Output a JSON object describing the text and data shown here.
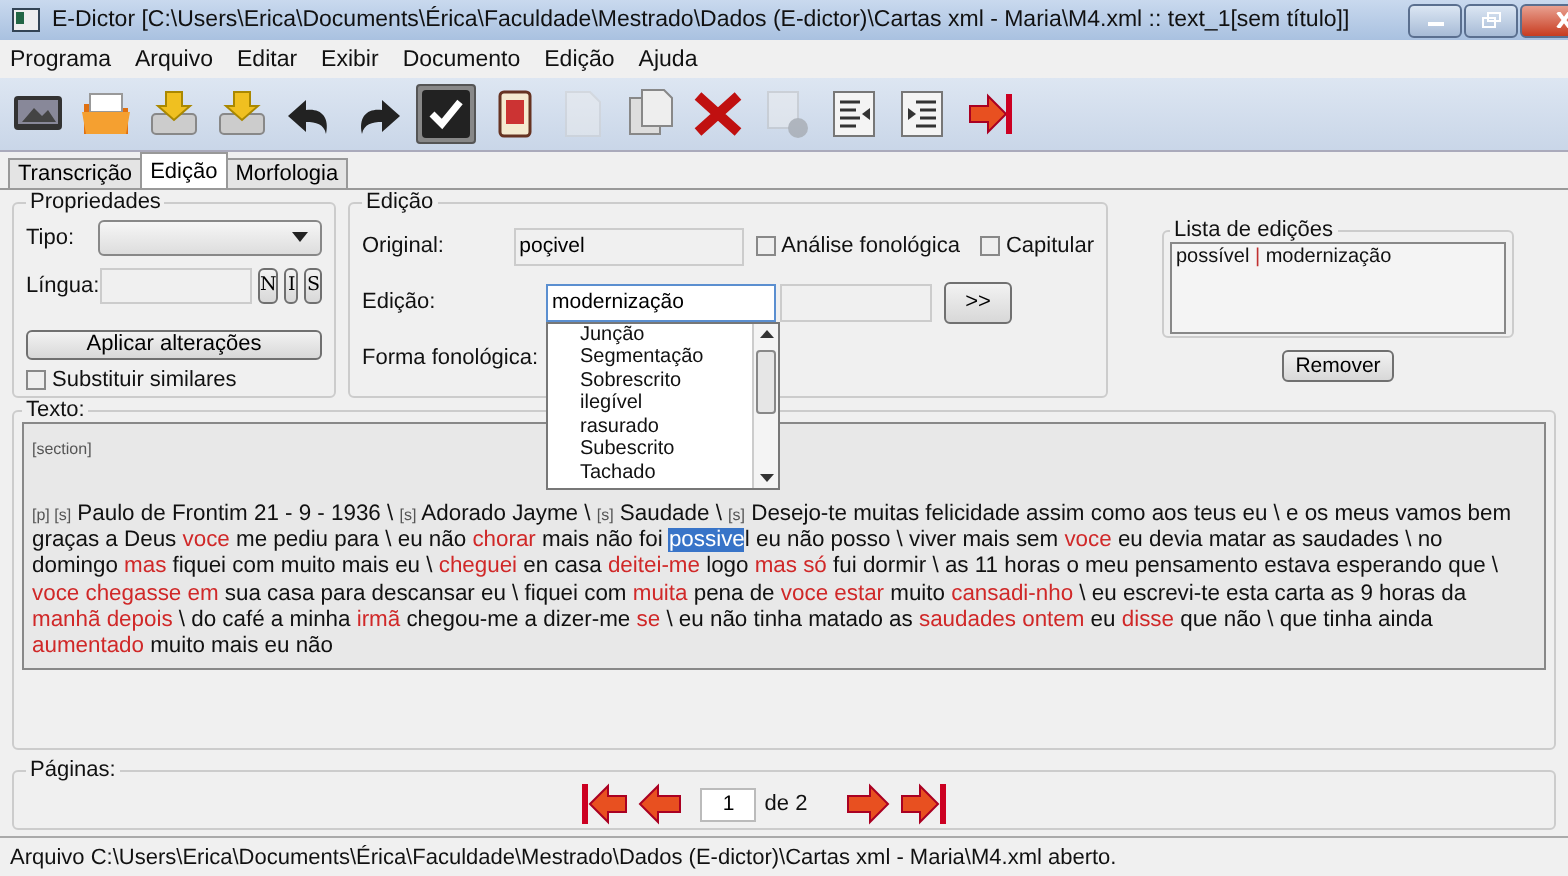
{
  "window": {
    "title": "E-Dictor [C:\\Users\\Erica\\Documents\\Érica\\Faculdade\\Mestrado\\Dados (E-dictor)\\Cartas xml - Maria\\M4.xml :: text_1[sem título]]"
  },
  "menu": [
    "Programa",
    "Arquivo",
    "Editar",
    "Exibir",
    "Documento",
    "Edição",
    "Ajuda"
  ],
  "toolbar": [
    {
      "disabled": false,
      "pressed": false
    },
    {
      "disabled": false,
      "pressed": false
    },
    {
      "disabled": false,
      "pressed": false
    },
    {
      "disabled": false,
      "pressed": false
    },
    {
      "disabled": false,
      "pressed": false
    },
    {
      "disabled": false,
      "pressed": false
    },
    {
      "disabled": false,
      "pressed": true
    },
    {
      "disabled": false,
      "pressed": false
    },
    {
      "disabled": true,
      "pressed": false
    },
    {
      "disabled": false,
      "pressed": false
    },
    {
      "disabled": false,
      "pressed": false
    },
    {
      "disabled": true,
      "pressed": false
    },
    {
      "disabled": false,
      "pressed": false
    },
    {
      "disabled": false,
      "pressed": false
    },
    {
      "disabled": false,
      "pressed": false
    }
  ],
  "tabs": [
    {
      "label": "Transcrição",
      "selected": false
    },
    {
      "label": "Edição",
      "selected": true
    },
    {
      "label": "Morfologia",
      "selected": false
    }
  ],
  "properties": {
    "title": "Propriedades",
    "type_label": "Tipo:",
    "language_label": "Língua:",
    "language_buttons": [
      "N",
      "I",
      "S"
    ],
    "apply_button": "Aplicar alterações",
    "replace_similar": {
      "label": "Substituir similares",
      "checked": false
    }
  },
  "edition": {
    "title": "Edição",
    "original_label": "Original:",
    "original_value": "poçivel",
    "phonological_analysis": {
      "label": "Análise fonológica",
      "checked": false
    },
    "capitular": {
      "label": "Capitular",
      "checked": false
    },
    "edition_label": "Edição:",
    "edition_value": "modernização",
    "go_button": ">>",
    "phonological_form_label": "Forma fonológica:",
    "dropdown": [
      "Junção",
      "Segmentação",
      "Sobrescrito",
      "ilegível",
      "rasurado",
      "Subescrito",
      "Tachado"
    ]
  },
  "edit_list": {
    "title": "Lista de edições",
    "items": [
      {
        "original": "possível",
        "separator": "|",
        "edition": "modernização"
      }
    ],
    "remove_button": "Remover"
  },
  "text": {
    "title": "Texto:",
    "section_tag": "[section]",
    "segments": [
      {
        "kind": "tag",
        "text": "[p] [s]"
      },
      {
        "kind": "plain",
        "text": " Paulo de Frontim 21 - 9 - 1936 \\ "
      },
      {
        "kind": "tag",
        "text": "[s]"
      },
      {
        "kind": "plain",
        "text": " Adorado Jayme \\ "
      },
      {
        "kind": "tag",
        "text": "[s]"
      },
      {
        "kind": "plain",
        "text": " Saudade \\ "
      },
      {
        "kind": "tag",
        "text": "[s]"
      },
      {
        "kind": "plain",
        "text": " Desejo-te muitas felicidade assim como aos teus eu \\ e os meus vamos bem graças a Deus "
      },
      {
        "kind": "edited",
        "text": "voce"
      },
      {
        "kind": "plain",
        "text": " me pediu para \\ eu não "
      },
      {
        "kind": "edited",
        "text": "chorar"
      },
      {
        "kind": "plain",
        "text": " mais não foi "
      },
      {
        "kind": "selected",
        "text": "possive"
      },
      {
        "kind": "plain",
        "text": "l eu não posso \\ viver mais sem "
      },
      {
        "kind": "edited",
        "text": "voce"
      },
      {
        "kind": "plain",
        "text": " eu devia matar as saudades \\ no domingo "
      },
      {
        "kind": "edited",
        "text": "mas"
      },
      {
        "kind": "plain",
        "text": " fiquei com muito mais eu \\ "
      },
      {
        "kind": "edited",
        "text": "cheguei"
      },
      {
        "kind": "plain",
        "text": " en casa "
      },
      {
        "kind": "edited",
        "text": "deitei-me"
      },
      {
        "kind": "plain",
        "text": " logo "
      },
      {
        "kind": "edited",
        "text": "mas só"
      },
      {
        "kind": "plain",
        "text": " fui dormir \\ as 11 horas o meu pensamento estava esperando que \\ "
      },
      {
        "kind": "edited",
        "text": "voce chegasse em"
      },
      {
        "kind": "plain",
        "text": " sua casa para descansar eu \\ fiquei com "
      },
      {
        "kind": "edited",
        "text": "muita"
      },
      {
        "kind": "plain",
        "text": " pena de "
      },
      {
        "kind": "edited",
        "text": "voce estar"
      },
      {
        "kind": "plain",
        "text": " muito "
      },
      {
        "kind": "edited",
        "text": "cansadi-nho"
      },
      {
        "kind": "plain",
        "text": " \\ eu escrevi-te esta carta as 9 horas da "
      },
      {
        "kind": "edited",
        "text": "manhã depois"
      },
      {
        "kind": "plain",
        "text": " \\ do café a minha "
      },
      {
        "kind": "edited",
        "text": "irmã"
      },
      {
        "kind": "plain",
        "text": " chegou-me a dizer-me "
      },
      {
        "kind": "edited",
        "text": "se"
      },
      {
        "kind": "plain",
        "text": " \\ eu não tinha matado as "
      },
      {
        "kind": "edited",
        "text": "saudades ontem"
      },
      {
        "kind": "plain",
        "text": " eu "
      },
      {
        "kind": "edited",
        "text": "disse"
      },
      {
        "kind": "plain",
        "text": " que não \\ que tinha ainda "
      },
      {
        "kind": "edited",
        "text": "aumentado"
      },
      {
        "kind": "plain",
        "text": " muito mais eu não"
      }
    ]
  },
  "pages": {
    "title": "Páginas:",
    "current": "1",
    "of": "de 2"
  },
  "status_bar": "Arquivo C:\\Users\\Erica\\Documents\\Érica\\Faculdade\\Mestrado\\Dados (E-dictor)\\Cartas xml - Maria\\M4.xml aberto."
}
